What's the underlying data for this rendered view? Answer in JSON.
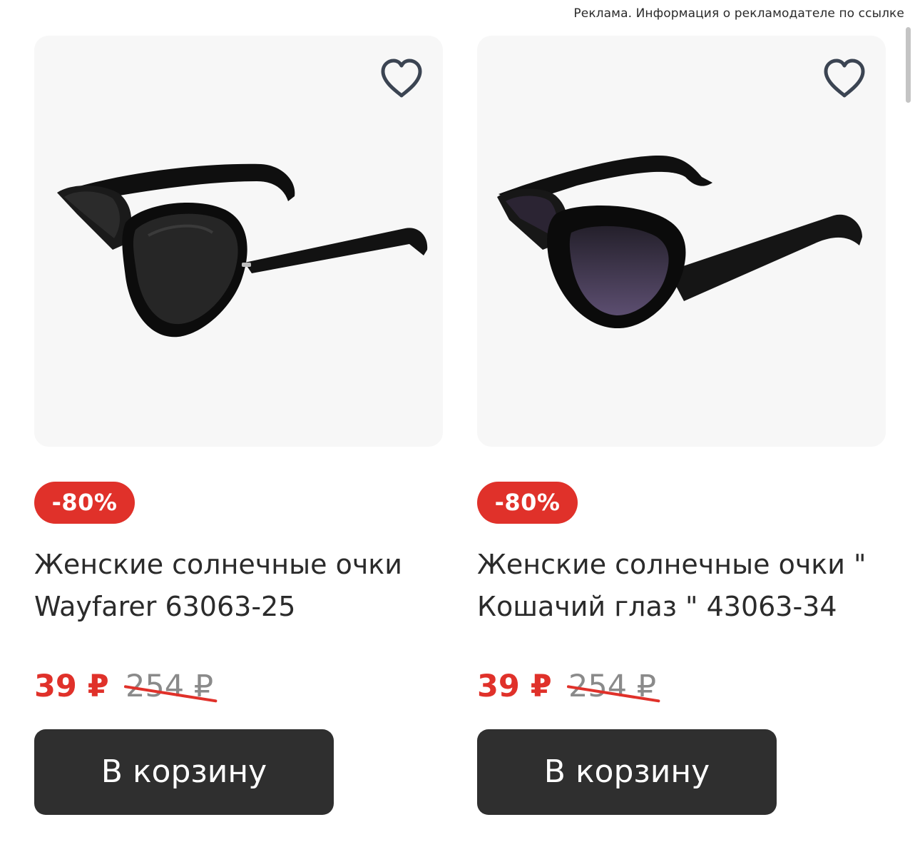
{
  "ad_notice": "Реклама. Информация о рекламодателе по ссылке",
  "colors": {
    "accent_red": "#e0312a",
    "button_dark": "#2f2f2f",
    "card_bg": "#f7f7f7",
    "old_price_gray": "#8a8a8a"
  },
  "products": [
    {
      "image": "black-cat-eye-sunglasses",
      "favorite_icon": "heart-outline-icon",
      "discount": "-80%",
      "title_line1": "Женские солнечные очки",
      "title_line2": "Wayfarer 63063-25",
      "price_new": "39 ₽",
      "price_old": "254 ₽",
      "cart_label": "В корзину"
    },
    {
      "image": "black-cat-eye-sunglasses-purple-lens",
      "favorite_icon": "heart-outline-icon",
      "discount": "-80%",
      "title_line1": "Женские солнечные очки \"",
      "title_line2": "Кошачий глаз \" 43063-34",
      "price_new": "39 ₽",
      "price_old": "254 ₽",
      "cart_label": "В корзину"
    }
  ]
}
